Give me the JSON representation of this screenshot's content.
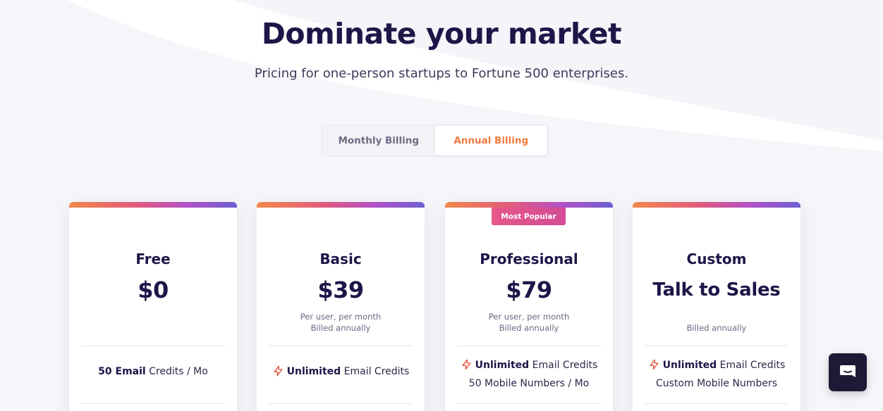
{
  "hero": {
    "title": "Dominate your market",
    "subtitle": "Pricing for one-person startups to Fortune 500 enterprises."
  },
  "billing_toggle": {
    "monthly": "Monthly Billing",
    "annual": "Annual Billing",
    "selected": "annual"
  },
  "plans": [
    {
      "name": "Free",
      "price": "$0",
      "features": [
        {
          "bold": "50 Email",
          "text": " Credits / Mo"
        }
      ]
    },
    {
      "name": "Basic",
      "price": "$39",
      "note_line1": "Per user, per month",
      "note_line2": "Billed annually",
      "features": [
        {
          "bold": "Unlimited",
          "text": " Email Credits"
        }
      ]
    },
    {
      "name": "Professional",
      "badge": "Most Popular",
      "price": "$79",
      "note_line1": "Per user, per month",
      "note_line2": "Billed annually",
      "features": [
        {
          "bold": "Unlimited",
          "text": " Email Credits"
        },
        {
          "text": "50 Mobile Numbers / Mo"
        }
      ]
    },
    {
      "name": "Custom",
      "price": "Talk to Sales",
      "note_line2": "Billed annually",
      "features": [
        {
          "bold": "Unlimited",
          "text": " Email Credits"
        },
        {
          "text": "Custom Mobile Numbers"
        }
      ]
    }
  ],
  "icons": {
    "feature": "lightning-bolt-icon",
    "chat": "chat-bubble-icon"
  },
  "colors": {
    "heading": "#1e1548",
    "accent": "#f07a3e",
    "badge": "#e7588a",
    "chat_button": "#1e1a35"
  }
}
